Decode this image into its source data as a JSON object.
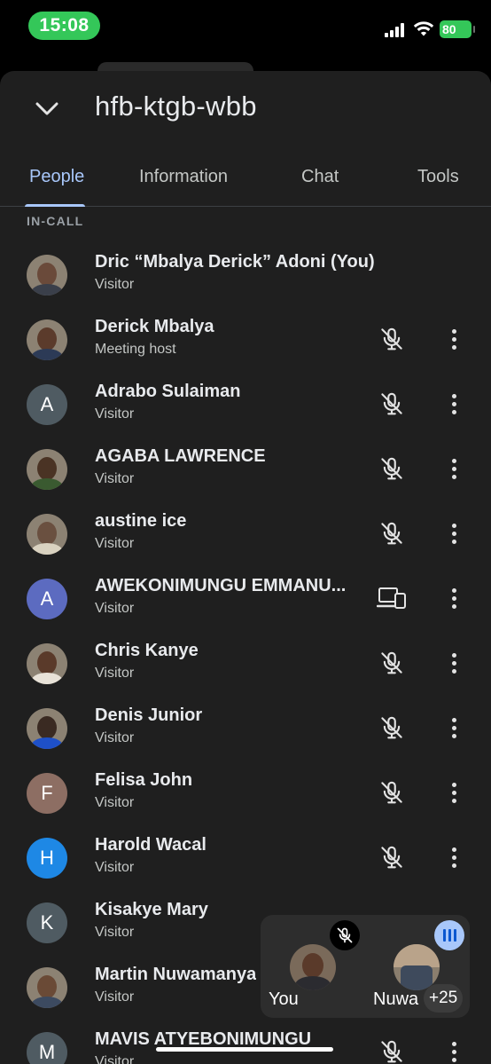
{
  "status_bar": {
    "time": "15:08",
    "battery": "80"
  },
  "meeting": {
    "code": "hfb-ktgb-wbb"
  },
  "tabs": [
    {
      "label": "People",
      "active": true
    },
    {
      "label": "Information",
      "active": false
    },
    {
      "label": "Chat",
      "active": false
    },
    {
      "label": "Tools",
      "active": false
    }
  ],
  "section_label": "IN-CALL",
  "participants": [
    {
      "name": "Dric “Mbalya Derick” Adoni (You)",
      "role": "Visitor",
      "avatar": "photo",
      "status_icon": "none"
    },
    {
      "name": "Derick Mbalya",
      "role": "Meeting host",
      "avatar": "photo",
      "status_icon": "mic-off-icon"
    },
    {
      "name": "Adrabo Sulaiman",
      "role": "Visitor",
      "avatar": "A",
      "avatar_color": "#4f5b62",
      "status_icon": "mic-off-icon"
    },
    {
      "name": "AGABA LAWRENCE",
      "role": "Visitor",
      "avatar": "photo",
      "status_icon": "mic-off-icon"
    },
    {
      "name": "austine ice",
      "role": "Visitor",
      "avatar": "photo",
      "status_icon": "mic-off-icon"
    },
    {
      "name": "AWEKONIMUNGU EMMANU...",
      "role": "Visitor",
      "avatar": "A",
      "avatar_color": "#5c6bc0",
      "status_icon": "devices-icon"
    },
    {
      "name": "Chris Kanye",
      "role": "Visitor",
      "avatar": "photo",
      "status_icon": "mic-off-icon"
    },
    {
      "name": "Denis Junior",
      "role": "Visitor",
      "avatar": "photo",
      "status_icon": "mic-off-icon"
    },
    {
      "name": "Felisa John",
      "role": "Visitor",
      "avatar": "F",
      "avatar_color": "#8d6e63",
      "status_icon": "mic-off-icon"
    },
    {
      "name": "Harold Wacal",
      "role": "Visitor",
      "avatar": "H",
      "avatar_color": "#1e88e5",
      "status_icon": "mic-off-icon"
    },
    {
      "name": "Kisakye Mary",
      "role": "Visitor",
      "avatar": "K",
      "avatar_color": "#4f5b62",
      "status_icon": "none"
    },
    {
      "name": "Martin Nuwamanya",
      "role": "Visitor",
      "avatar": "photo",
      "status_icon": "none"
    },
    {
      "name": "MAVIS ATYEBONIMUNGU",
      "role": "Visitor",
      "avatar": "M",
      "avatar_color": "#4f5b62",
      "status_icon": "mic-off-icon"
    }
  ],
  "pip": {
    "self_label": "You",
    "other_label": "Nuwa",
    "more_count": "+25"
  },
  "colors": {
    "accent": "#a8c7fa",
    "background": "#1f1f1f",
    "status_green": "#34c759"
  }
}
